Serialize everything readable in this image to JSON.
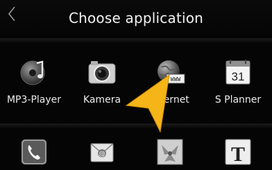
{
  "header": {
    "title": "Choose application",
    "back_icon": "chevron-left-icon"
  },
  "colors": {
    "background": "#050505",
    "pointer": "#f5b418"
  },
  "apps_row1": [
    {
      "label": "MP3-Player",
      "icon": "music-player-icon"
    },
    {
      "label": "Kamera",
      "icon": "camera-icon"
    },
    {
      "label": "Internet",
      "icon": "globe-icon"
    },
    {
      "label": "S Planner",
      "icon": "calendar-icon",
      "icon_text": "31"
    }
  ],
  "apps_row2": [
    {
      "icon": "phone-icon"
    },
    {
      "icon": "email-icon"
    },
    {
      "icon": "gallery-icon"
    },
    {
      "icon": "text-icon",
      "icon_text": "T"
    }
  ]
}
